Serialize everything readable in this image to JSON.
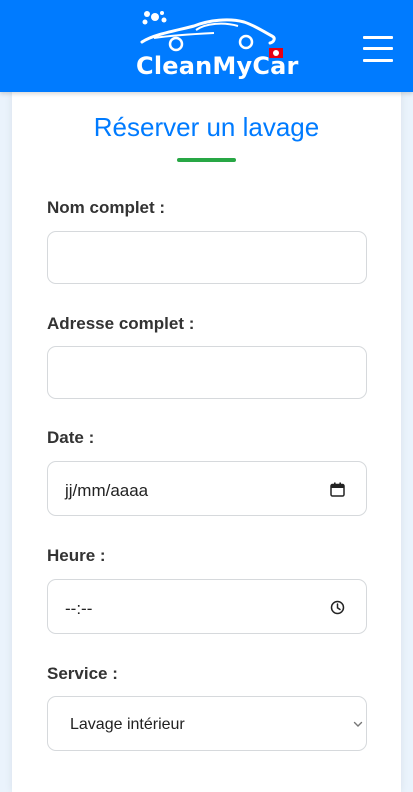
{
  "header": {
    "logo_text": "CleanMyCar",
    "menu_icon": "hamburger-menu-icon",
    "color": "#007bff"
  },
  "form": {
    "title": "Réserver un lavage",
    "title_color": "#007bff",
    "underline_color": "#28a745",
    "fields": {
      "name": {
        "label": "Nom complet :",
        "value": ""
      },
      "address": {
        "label": "Adresse complet :",
        "value": ""
      },
      "date": {
        "label": "Date :",
        "placeholder": "jj/mm/aaaa",
        "icon": "calendar-icon"
      },
      "time": {
        "label": "Heure :",
        "placeholder": "--:--",
        "icon": "clock-icon"
      },
      "service": {
        "label": "Service :",
        "selected": "Lavage intérieur",
        "icon": "chevron-down-icon"
      }
    }
  }
}
